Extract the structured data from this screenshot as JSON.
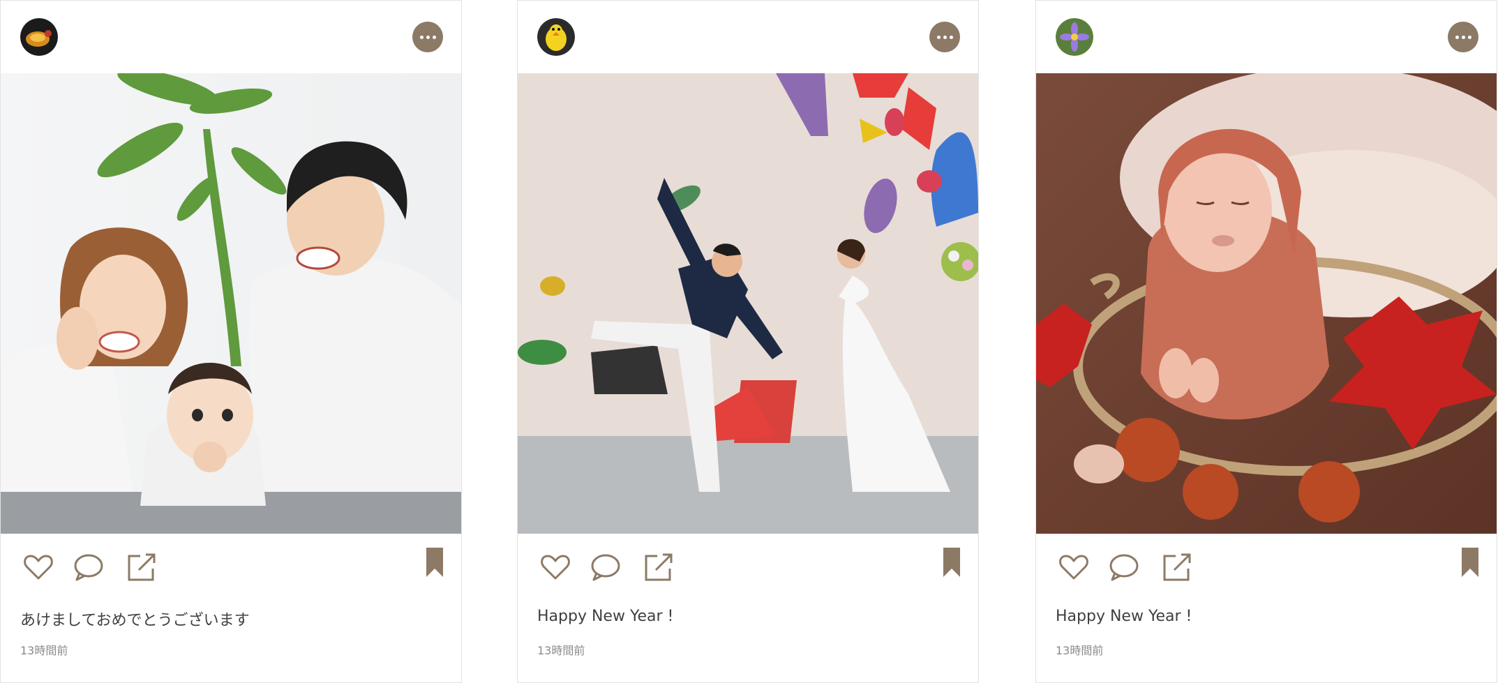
{
  "accent_color": "#8c7a66",
  "posts": [
    {
      "avatar_icon": "bird-avatar",
      "more_icon": "more-dots-icon",
      "photo": "family-with-baby-photo",
      "caption": "あけましておめでとうございます",
      "time": "13時間前"
    },
    {
      "avatar_icon": "yellow-bird-avatar",
      "more_icon": "more-dots-icon",
      "photo": "wedding-couple-climbing-wall-photo",
      "caption": "Happy New Year !",
      "time": "13時間前"
    },
    {
      "avatar_icon": "flower-avatar",
      "more_icon": "more-dots-icon",
      "photo": "newborn-in-basket-photo",
      "caption": "Happy New Year !",
      "time": "13時間前"
    }
  ]
}
